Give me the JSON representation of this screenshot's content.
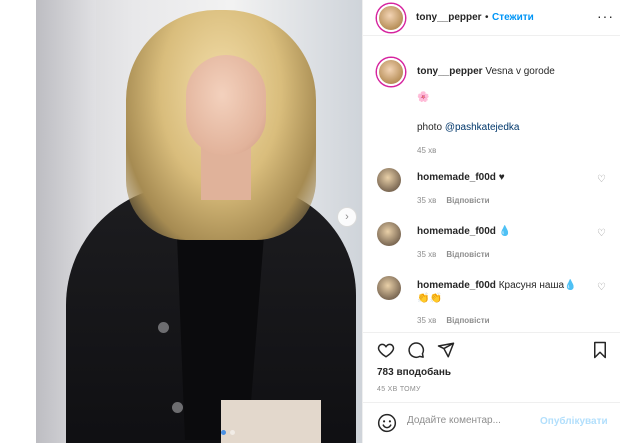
{
  "post": {
    "username": "tony__pepper",
    "separator": "•",
    "follow_label": "Стежити",
    "more_label": "···",
    "caption_text": "Vesna v gorode",
    "caption_emoji": "🌸",
    "photo_credit_prefix": "photo",
    "photo_credit_mention": "@pashkatejedka",
    "caption_time": "45 хв"
  },
  "comments": [
    {
      "username": "homemade_f00d",
      "text": "♥",
      "second_line": "",
      "time": "35 хв",
      "reply_label": "Відповісти"
    },
    {
      "username": "homemade_f00d",
      "text": "💧",
      "second_line": "",
      "time": "35 хв",
      "reply_label": "Відповісти"
    },
    {
      "username": "homemade_f00d",
      "text": "Красуня наша💧",
      "second_line": "👏👏",
      "time": "35 хв",
      "reply_label": "Відповісти"
    }
  ],
  "actions": {
    "likes_count": "783",
    "likes_label": "вподобань",
    "posted_ago": "45 ХВ ТОМУ"
  },
  "add_comment": {
    "placeholder": "Додайте коментар...",
    "post_label": "Опублікувати"
  },
  "carousel": {
    "next_label": "›",
    "slide_count": 2,
    "active_slide": 1
  },
  "colors": {
    "accent": "#0095f6",
    "muted": "#8e8e8e",
    "text": "#262626",
    "post_disabled": "#b2dffc"
  }
}
